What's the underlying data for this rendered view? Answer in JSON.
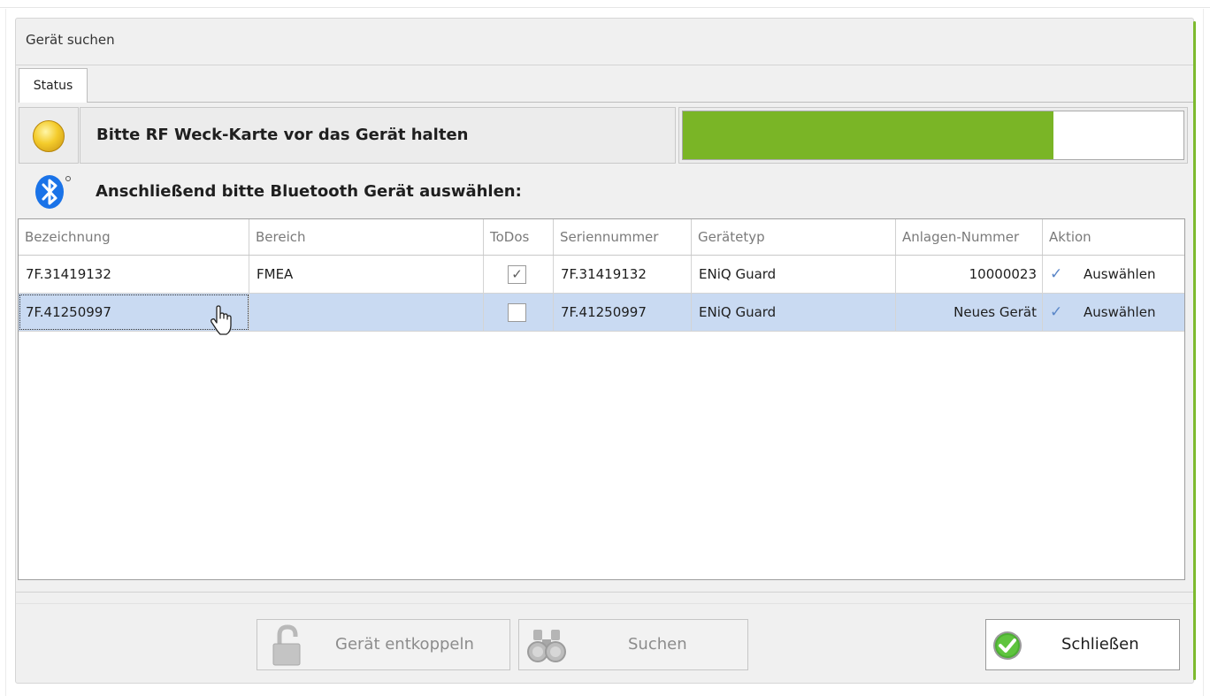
{
  "window": {
    "title": "Gerät suchen"
  },
  "tabs": [
    {
      "label": "Status",
      "active": true
    }
  ],
  "status": {
    "indicator_color": "#f4cc2c",
    "message": "Bitte RF Weck-Karte vor das Gerät halten",
    "progress_fraction": 0.74,
    "progress_color": "#7ab526"
  },
  "bluetooth": {
    "icon": "bluetooth-icon",
    "message": "Anschließend bitte Bluetooth Gerät auswählen:"
  },
  "table": {
    "columns": [
      "Bezeichnung",
      "Bereich",
      "ToDos",
      "Seriennummer",
      "Gerätetyp",
      "Anlagen-Nummer",
      "Aktion"
    ],
    "rows": [
      {
        "bezeichnung": "7F.31419132",
        "bereich": "FMEA",
        "todos": true,
        "seriennummer": "7F.31419132",
        "geraetetyp": "ENiQ Guard",
        "anlagen_nummer": "10000023",
        "aktion": "Auswählen",
        "selected": false
      },
      {
        "bezeichnung": "7F.41250997",
        "bereich": "",
        "todos": false,
        "seriennummer": "7F.41250997",
        "geraetetyp": "ENiQ Guard",
        "anlagen_nummer": "Neues Gerät",
        "aktion": "Auswählen",
        "selected": true
      }
    ]
  },
  "buttons": {
    "entkoppeln": {
      "label": "Gerät entkoppeln",
      "icon": "unlocked-padlock-icon",
      "enabled": false
    },
    "suchen": {
      "label": "Suchen",
      "icon": "binoculars-icon",
      "enabled": false
    },
    "schliessen": {
      "label": "Schließen",
      "icon": "green-check-icon",
      "enabled": true
    }
  },
  "colors": {
    "accent": "#7dba2f",
    "selected_row": "#c9daf2",
    "bluetooth": "#1a73e8"
  }
}
